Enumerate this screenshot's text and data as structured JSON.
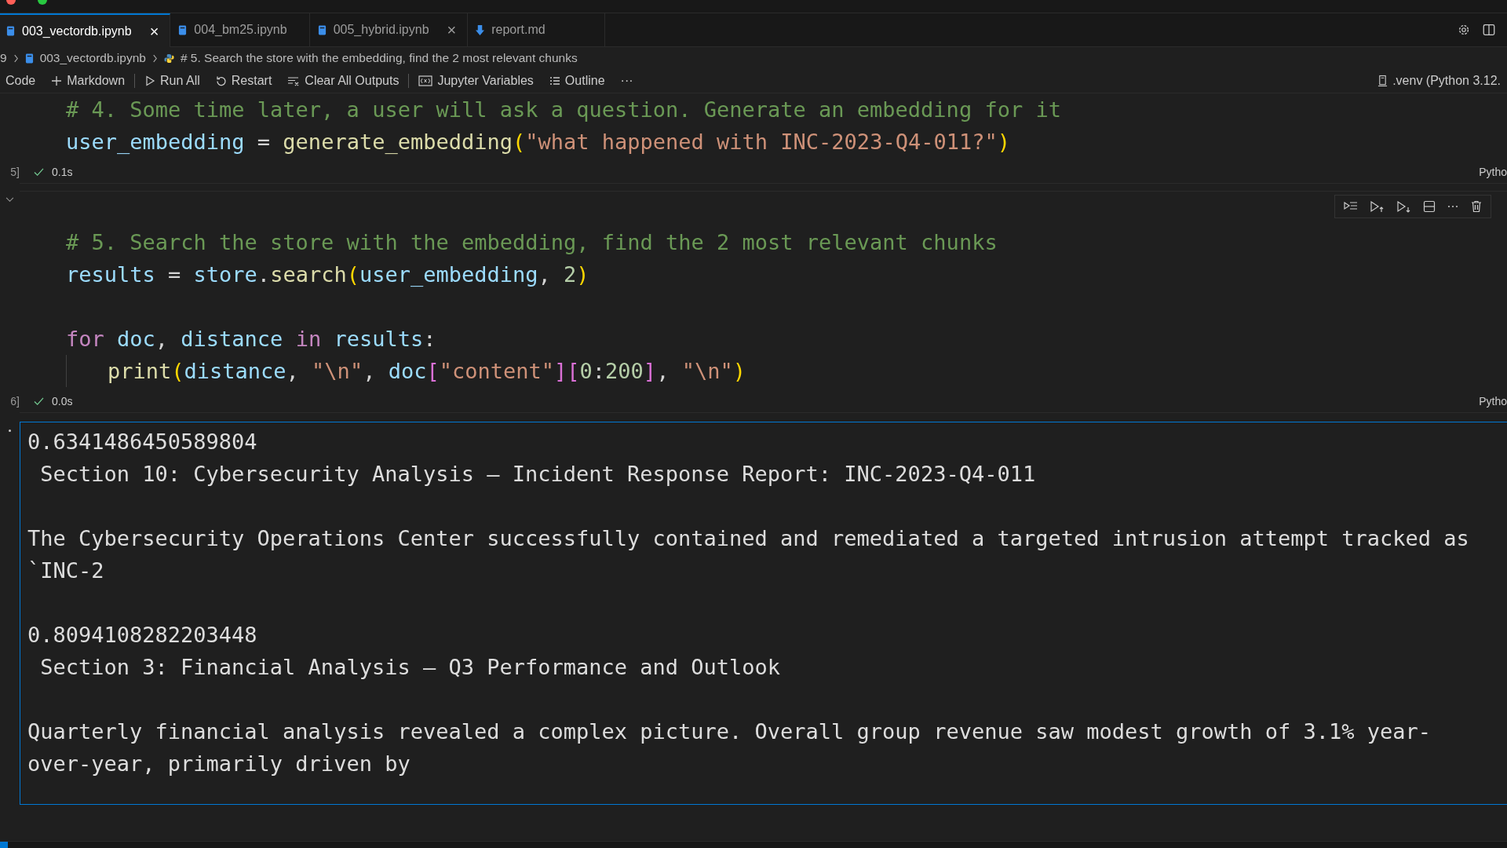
{
  "tabs": [
    {
      "label": "003_vectordb.ipynb",
      "kind": "notebook",
      "selected": true,
      "closable": true
    },
    {
      "label": "004_bm25.ipynb",
      "kind": "notebook",
      "selected": false,
      "closable": false
    },
    {
      "label": "005_hybrid.ipynb",
      "kind": "notebook",
      "selected": false,
      "closable": true
    },
    {
      "label": "report.md",
      "kind": "markdown",
      "selected": false,
      "closable": false
    }
  ],
  "tab_close": "×",
  "breadcrumb": [
    "9",
    "003_vectordb.ipynb",
    "# 5. Search the store with the embedding, find the 2 most relevant chunks"
  ],
  "toolbar": [
    {
      "label": "Code",
      "kind": "text",
      "separator_before": false
    },
    {
      "label": "Markdown",
      "kind": "plus",
      "separator_before": false
    },
    {
      "label": "Run All",
      "kind": "run",
      "separator_before": true
    },
    {
      "label": "Restart",
      "kind": "restart",
      "separator_before": false
    },
    {
      "label": "Clear All Outputs",
      "kind": "clear",
      "separator_before": false
    },
    {
      "label": "Jupyter Variables",
      "kind": "variables",
      "separator_before": true
    },
    {
      "label": "Outline",
      "kind": "outline",
      "separator_before": false
    },
    {
      "label": "···",
      "kind": "text",
      "separator_before": false
    }
  ],
  "kernel": ".venv (Python 3.12.",
  "cells": [
    {
      "execution": "5]",
      "time": "0.1s",
      "language": "Pytho",
      "toolbar": false,
      "blocks": [
        {
          "lines": [
            {
              "tokens": [
                {
                  "t": "# 4. Some time later, a user will ask a question. Generate an embedding for it",
                  "kind": "comment"
                }
              ]
            },
            {
              "tokens": [
                {
                  "t": "user_embedding",
                  "kind": "variable"
                },
                {
                  "t": " = ",
                  "kind": "plain"
                },
                {
                  "t": "generate_embedding",
                  "kind": "function"
                },
                {
                  "t": "(",
                  "kind": "bracket"
                },
                {
                  "t": "\"what happened with INC-2023-Q4-011?\"",
                  "kind": "string"
                },
                {
                  "t": ")",
                  "kind": "bracket"
                }
              ]
            }
          ]
        }
      ]
    },
    {
      "execution": "6]",
      "time": "0.0s",
      "language": "Pytho",
      "toolbar": true,
      "blocks": [
        {
          "lines": [
            {
              "tokens": [
                {
                  "t": "# 5. Search the store with the embedding, find the 2 most relevant chunks",
                  "kind": "comment"
                }
              ]
            },
            {
              "tokens": [
                {
                  "t": "results",
                  "kind": "variable"
                },
                {
                  "t": " = ",
                  "kind": "plain"
                },
                {
                  "t": "store",
                  "kind": "variable"
                },
                {
                  "t": ".",
                  "kind": "plain"
                },
                {
                  "t": "search",
                  "kind": "function"
                },
                {
                  "t": "(",
                  "kind": "bracket"
                },
                {
                  "t": "user_embedding",
                  "kind": "variable"
                },
                {
                  "t": ", ",
                  "kind": "plain"
                },
                {
                  "t": "2",
                  "kind": "number"
                },
                {
                  "t": ")",
                  "kind": "bracket"
                }
              ]
            }
          ]
        },
        {
          "lines": [
            {
              "tokens": [
                {
                  "t": "for",
                  "kind": "keyword"
                },
                {
                  "t": " doc",
                  "kind": "variable"
                },
                {
                  "t": ", ",
                  "kind": "plain"
                },
                {
                  "t": "distance",
                  "kind": "variable"
                },
                {
                  "t": " in",
                  "kind": "keyword"
                },
                {
                  "t": " results",
                  "kind": "variable"
                },
                {
                  "t": ":",
                  "kind": "plain"
                }
              ],
              "children": [
                {
                  "tokens": [
                    {
                      "t": "print",
                      "kind": "function"
                    },
                    {
                      "t": "(",
                      "kind": "bracket"
                    },
                    {
                      "t": "distance",
                      "kind": "variable"
                    },
                    {
                      "t": ", ",
                      "kind": "plain"
                    },
                    {
                      "t": "\"\\n\"",
                      "kind": "string"
                    },
                    {
                      "t": ", ",
                      "kind": "plain"
                    },
                    {
                      "t": "doc",
                      "kind": "variable"
                    },
                    {
                      "t": "[",
                      "kind": "bracket2"
                    },
                    {
                      "t": "\"content\"",
                      "kind": "string"
                    },
                    {
                      "t": "]",
                      "kind": "bracket2"
                    },
                    {
                      "t": "[",
                      "kind": "bracket2"
                    },
                    {
                      "t": "0",
                      "kind": "number"
                    },
                    {
                      "t": ":",
                      "kind": "plain"
                    },
                    {
                      "t": "200",
                      "kind": "number"
                    },
                    {
                      "t": "]",
                      "kind": "bracket2"
                    },
                    {
                      "t": ", ",
                      "kind": "plain"
                    },
                    {
                      "t": "\"\\n\"",
                      "kind": "string"
                    },
                    {
                      "t": ")",
                      "kind": "bracket"
                    }
                  ]
                }
              ]
            }
          ]
        }
      ]
    }
  ],
  "output": [
    {
      "distance": "0.6341486450589804",
      "heading": " Section 10: Cybersecurity Analysis – Incident Response Report: INC-2023-Q4-011",
      "body": [
        "The Cybersecurity Operations Center successfully contained and remediated a targeted intrusion attempt tracked as",
        "`INC-2"
      ]
    },
    {
      "distance": "0.8094108282203448",
      "heading": " Section 3: Financial Analysis – Q3 Performance and Outlook",
      "body": [
        "Quarterly financial analysis revealed a complex picture. Overall group revenue saw modest growth of 3.1% year-",
        "over-year, primarily driven by"
      ]
    }
  ]
}
